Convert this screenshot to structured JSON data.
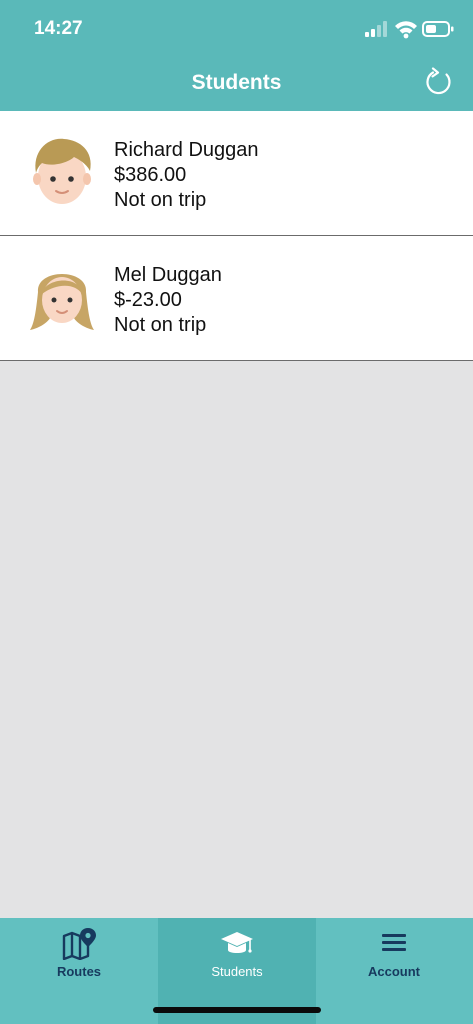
{
  "status_bar": {
    "time": "14:27"
  },
  "header": {
    "title": "Students"
  },
  "students": [
    {
      "name": "Richard Duggan",
      "balance": "$386.00",
      "status": "Not on trip",
      "avatar": "boy-avatar-icon"
    },
    {
      "name": "Mel Duggan",
      "balance": "$-23.00",
      "status": "Not on trip",
      "avatar": "girl-avatar-icon"
    }
  ],
  "tabs": [
    {
      "label": "Routes",
      "icon": "map-pin-icon"
    },
    {
      "label": "Students",
      "icon": "graduation-cap-icon",
      "active": true
    },
    {
      "label": "Account",
      "icon": "hamburger-menu-icon"
    }
  ],
  "colors": {
    "header": "#5ab9b9",
    "tabbar": "#62c0c0",
    "tab_active": "#50b2b2",
    "tab_text": "#173a5e",
    "background": "#e3e3e4"
  }
}
